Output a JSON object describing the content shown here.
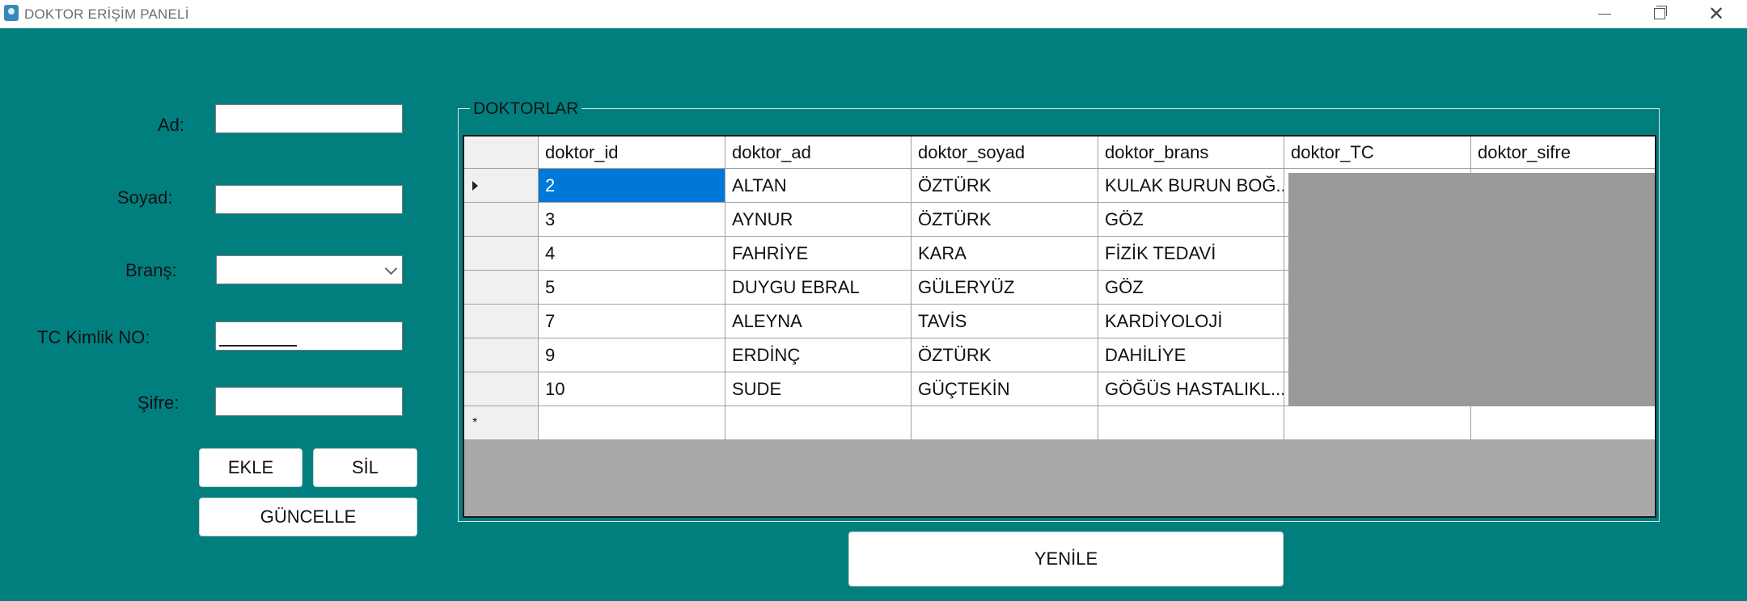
{
  "window": {
    "title": "DOKTOR ERİŞİM PANELİ"
  },
  "form": {
    "labels": {
      "ad": "Ad:",
      "soyad": "Soyad:",
      "brans": "Branş:",
      "tc": "TC Kimlik NO:",
      "sifre": "Şifre:"
    },
    "values": {
      "ad": "",
      "soyad": "",
      "brans": "",
      "tc": "",
      "sifre": ""
    }
  },
  "buttons": {
    "ekle": "EKLE",
    "sil": "SİL",
    "guncelle": "GÜNCELLE",
    "yenile": "YENİLE"
  },
  "group": {
    "title": "DOKTORLAR"
  },
  "table": {
    "columns": [
      "doktor_id",
      "doktor_ad",
      "doktor_soyad",
      "doktor_brans",
      "doktor_TC",
      "doktor_sifre"
    ],
    "rows": [
      [
        "2",
        "ALTAN",
        "ÖZTÜRK",
        "KULAK BURUN BOĞ...",
        "",
        ""
      ],
      [
        "3",
        "AYNUR",
        "ÖZTÜRK",
        "GÖZ",
        "",
        ""
      ],
      [
        "4",
        "FAHRİYE",
        "KARA",
        "FİZİK TEDAVİ",
        "",
        ""
      ],
      [
        "5",
        "DUYGU EBRAL",
        "GÜLERYÜZ",
        "GÖZ",
        "",
        ""
      ],
      [
        "7",
        "ALEYNA",
        "TAVİS",
        "KARDİYOLOJİ",
        "",
        ""
      ],
      [
        "9",
        "ERDİNÇ",
        "ÖZTÜRK",
        "DAHİLİYE",
        "",
        ""
      ],
      [
        "10",
        "SUDE",
        "GÜÇTEKİN",
        "GÖĞÜS HASTALIKL...",
        "",
        ""
      ]
    ],
    "new_row_marker": "*"
  },
  "colors": {
    "background": "#017f7f",
    "selection": "#0078d7"
  }
}
